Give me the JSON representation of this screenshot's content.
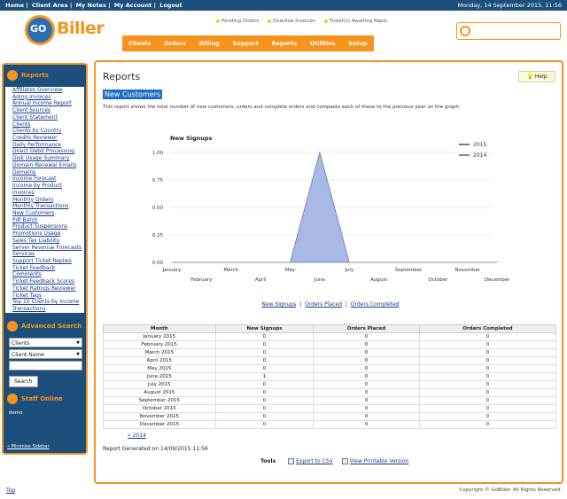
{
  "topbar": {
    "links": [
      "Home",
      "Client Area",
      "My Notes",
      "My Account",
      "Logout"
    ],
    "sep": "|",
    "datetime": "Monday, 14 September 2015, 11:56"
  },
  "logo": {
    "go": "GO",
    "biller": "Biller"
  },
  "alerts": [
    "Pending Orders",
    "Overdue Invoices",
    "Ticket(s) Awaiting Reply"
  ],
  "nav": [
    "Clients",
    "Orders",
    "Billing",
    "Support",
    "Reports",
    "Utilities",
    "Setup"
  ],
  "sidebar": {
    "reports_title": "Reports",
    "reports": [
      "Affiliates Overview",
      "Aging Invoices",
      "Annual Income Report",
      "Client Sources",
      "Client Statement",
      "Clients",
      "Clients by Country",
      "Credits Reviewer",
      "Daily Performance",
      "Direct Debit Processing",
      "Disk Usage Summary",
      "Domain Renewal Emails",
      "Domains",
      "Income Forecast",
      "Income by Product",
      "Invoices",
      "Monthly Orders",
      "Monthly Transactions",
      "New Customers",
      "Pdf Batch",
      "Product Suspensions",
      "Promotions Usage",
      "Sales Tax Liability",
      "Server Revenue Forecasts",
      "Services",
      "Support Ticket Replies",
      "Ticket Feedback Comments",
      "Ticket Feedback Scores",
      "Ticket Ratings Reviewer",
      "Ticket Tags",
      "Top 10 Clients by Income",
      "Transactions"
    ],
    "adv_title": "Advanced Search",
    "select1": "Clients",
    "select2": "Client Name",
    "search_btn": "Search",
    "staff_title": "Staff Online",
    "staff_name": "demo",
    "minimize": "« Minimise Sidebar"
  },
  "main": {
    "title": "Reports",
    "help": "Help",
    "subtitle": "New Customers",
    "desc": "This report shows the total number of new customers, orders and complete orders and compares each of these to the previous year on the graph.",
    "chart_links": [
      "New Signups",
      "Orders Placed",
      "Orders Completed"
    ],
    "table_headers": [
      "Month",
      "New Signups",
      "Orders Placed",
      "Orders Completed"
    ],
    "prev": "« 2014",
    "generated": "Report Generated on 14/09/2015 11:56",
    "tools_label": "Tools",
    "export": "Export to CSV",
    "printable": "View Printable Version"
  },
  "chart_data": {
    "type": "area",
    "title": "New Signups",
    "categories": [
      "January",
      "February",
      "March",
      "April",
      "May",
      "June",
      "July",
      "August",
      "September",
      "October",
      "November",
      "December"
    ],
    "series": [
      {
        "name": "2015",
        "values": [
          0,
          0,
          0,
          0,
          0,
          1,
          0,
          0,
          0,
          0,
          0,
          0
        ],
        "color": "#5b79c6"
      },
      {
        "name": "2014",
        "values": [
          0,
          0,
          0,
          0,
          0,
          0,
          0,
          0,
          0,
          0,
          0,
          0
        ],
        "color": "#888888"
      }
    ],
    "y_ticks": [
      "0.00",
      "0.25",
      "0.50",
      "0.75",
      "1.00"
    ],
    "ylim": [
      0,
      1
    ],
    "legend": "right",
    "grid": true
  },
  "rows": [
    [
      "January 2015",
      "0",
      "0",
      "0"
    ],
    [
      "February 2015",
      "0",
      "0",
      "0"
    ],
    [
      "March 2015",
      "0",
      "0",
      "0"
    ],
    [
      "April 2015",
      "0",
      "0",
      "0"
    ],
    [
      "May 2015",
      "0",
      "0",
      "0"
    ],
    [
      "June 2015",
      "1",
      "0",
      "0"
    ],
    [
      "July 2015",
      "0",
      "0",
      "0"
    ],
    [
      "August 2015",
      "0",
      "0",
      "0"
    ],
    [
      "September 2015",
      "0",
      "0",
      "0"
    ],
    [
      "October 2015",
      "0",
      "0",
      "0"
    ],
    [
      "November 2015",
      "0",
      "0",
      "0"
    ],
    [
      "December 2015",
      "0",
      "0",
      "0"
    ]
  ],
  "footer": {
    "top": "Top",
    "copyright": "Copyright © GoBiller. All Rights Reserved."
  }
}
